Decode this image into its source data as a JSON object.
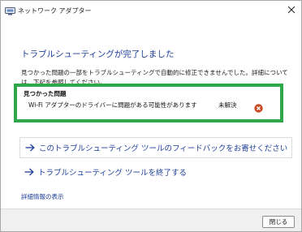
{
  "window": {
    "title": "ネットワーク アダプター"
  },
  "page": {
    "heading": "トラブルシューティングが完了しました",
    "description": "見つかった問題の一部をトラブルシューティングで自動的に修正できませんでした。詳細については、下記を参照してください。"
  },
  "problems": {
    "title": "見つかった問題",
    "items": [
      {
        "text": "Wi-Fi アダプターのドライバーに問題がある可能性があります",
        "status": "未解決",
        "status_icon": "error-x-icon",
        "status_color": "#c84a25"
      }
    ]
  },
  "actions": {
    "feedback_label": "このトラブルシューティング ツールのフィードバックをお寄せください",
    "exit_label": "トラブルシューティング ツールを終了する"
  },
  "details_link": "詳細情報の表示",
  "footer": {
    "close_label": "閉じる"
  },
  "colors": {
    "accent": "#1f3f9a",
    "highlight_frame": "#2fa84a",
    "error": "#c84a25"
  }
}
